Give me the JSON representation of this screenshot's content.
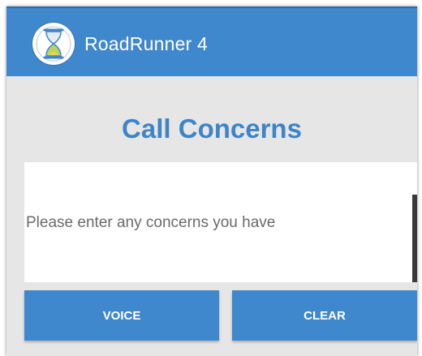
{
  "app": {
    "title": "RoadRunner 4",
    "logo_icon": "hourglass-logo-icon"
  },
  "page": {
    "title": "Call Concerns"
  },
  "concerns": {
    "value": "",
    "placeholder": "Please enter any concerns you have"
  },
  "actions": {
    "voice_label": "VOICE",
    "clear_label": "CLEAR"
  },
  "colors": {
    "primary": "#4088cd",
    "title": "#3e85c8",
    "background": "#e6e6e6"
  }
}
